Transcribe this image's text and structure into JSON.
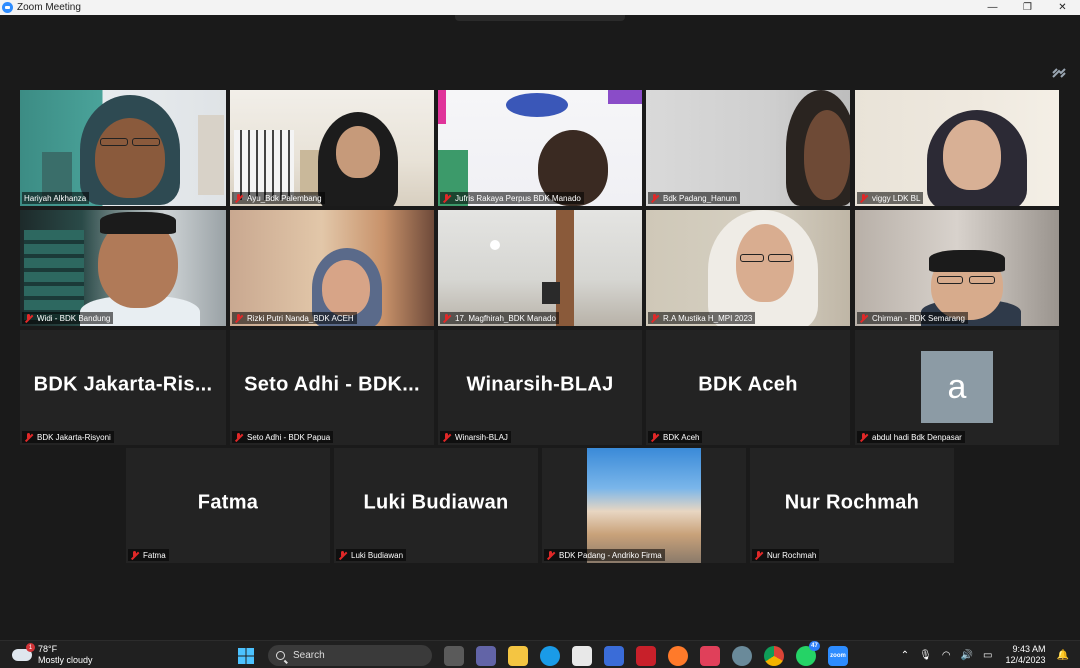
{
  "window": {
    "title": "Zoom Meeting",
    "controls": [
      "—",
      "❐",
      "✕"
    ]
  },
  "participants_video": [
    {
      "name": "Hariyah Alkhanza",
      "muted": false,
      "active_speaker": true
    },
    {
      "name": "Ayu_Bdk Palembang",
      "muted": true
    },
    {
      "name": "Jufris Rakaya Perpus BDK Manado",
      "muted": true
    },
    {
      "name": "Bdk Padang_Hanum",
      "muted": true
    },
    {
      "name": "viggy LDK BL",
      "muted": true
    },
    {
      "name": "Widi - BDK Bandung",
      "muted": true
    },
    {
      "name": "Rizki Putri Nanda_BDK ACEH",
      "muted": true
    },
    {
      "name": "17. Magfhirah_BDK Manado",
      "muted": true
    },
    {
      "name": "R.A Mustika H_MPI 2023",
      "muted": true
    },
    {
      "name": "Chirman - BDK Semarang",
      "muted": true
    }
  ],
  "participants_no_video": [
    {
      "display": "BDK Jakarta-Ris...",
      "name": "BDK Jakarta-Risyoni"
    },
    {
      "display": "Seto Adhi - BDK...",
      "name": "Seto Adhi - BDK Papua"
    },
    {
      "display": "Winarsih-BLAJ",
      "name": "Winarsih-BLAJ"
    },
    {
      "display": "BDK Aceh",
      "name": "BDK Aceh"
    },
    {
      "display": "a",
      "name": "abdul hadi Bdk Denpasar",
      "avatar": true
    }
  ],
  "participants_row4": [
    {
      "display": "Fatma",
      "name": "Fatma"
    },
    {
      "display": "Luki Budiawan",
      "name": "Luki Budiawan"
    },
    {
      "display": "",
      "name": "BDK Padang - Andriko Firma",
      "photo": true
    },
    {
      "display": "Nur Rochmah",
      "name": "Nur Rochmah"
    }
  ],
  "taskbar": {
    "weather_temp": "78°F",
    "weather_desc": "Mostly cloudy",
    "weather_badge": "1",
    "search_label": "Search",
    "whatsapp_badge": "47",
    "time": "9:43 AM",
    "date": "12/4/2023"
  },
  "colors": {
    "active_speaker": "#c8e04a",
    "muted_icon": "#e02828",
    "stage_bg": "#1a1a1a"
  }
}
